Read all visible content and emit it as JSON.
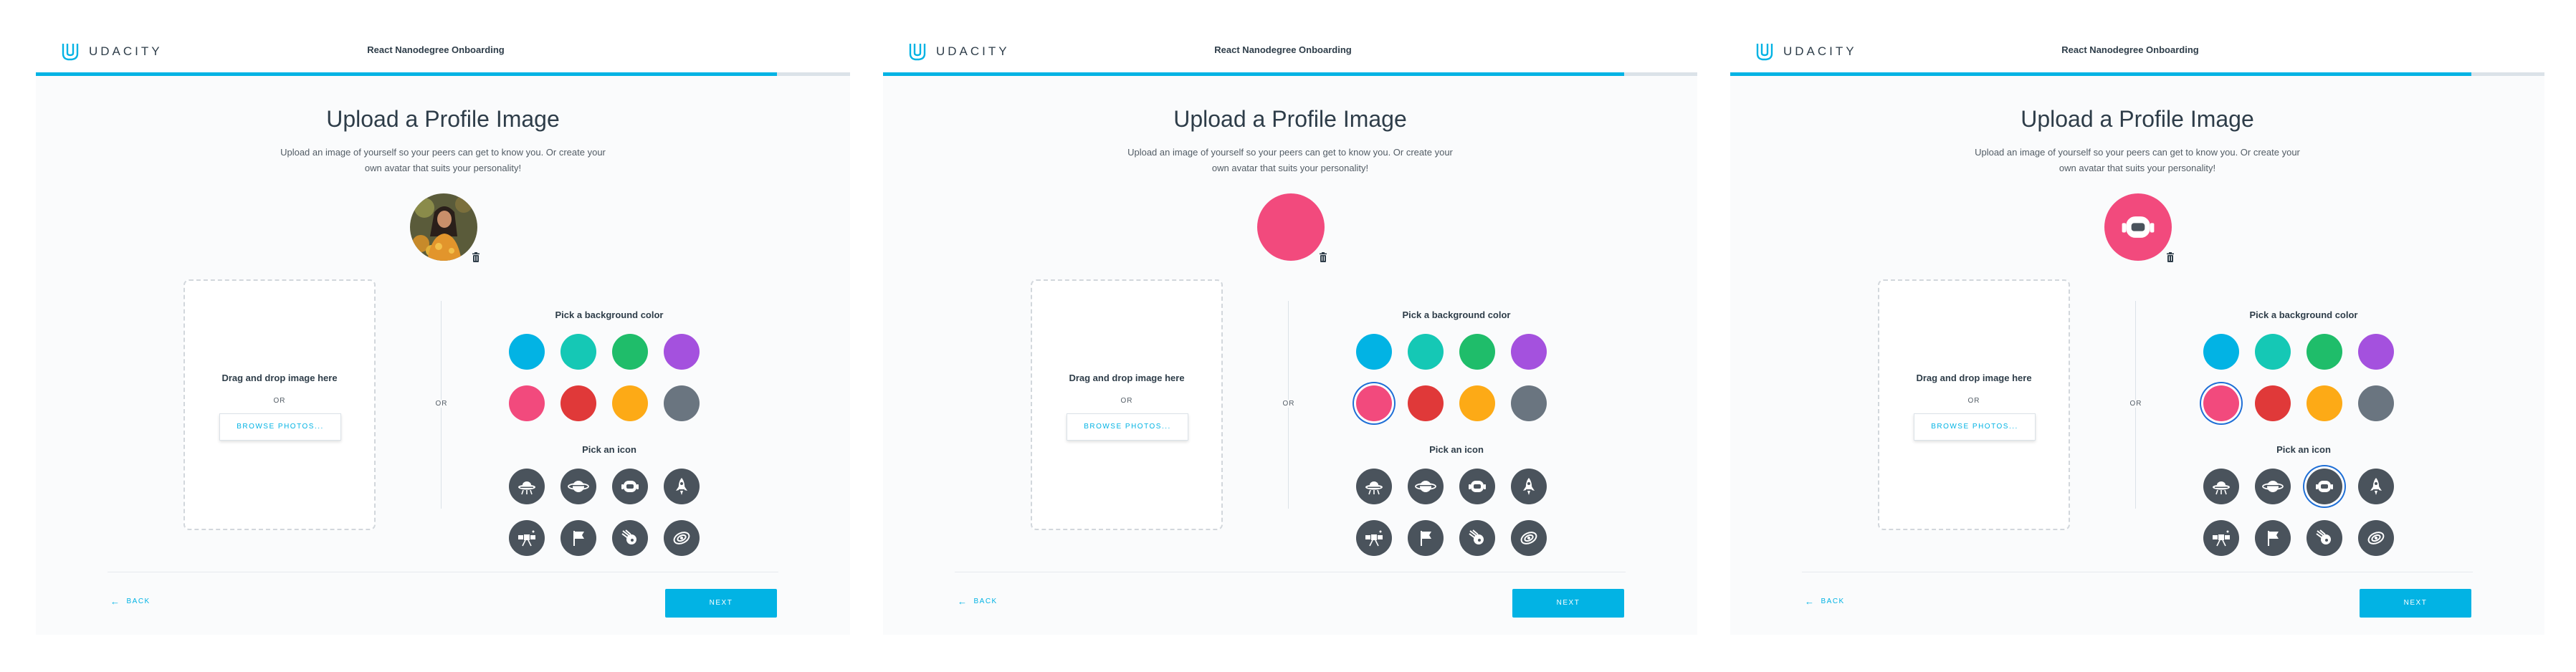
{
  "header": {
    "logo_text": "UDACITY",
    "course_title": "React Nanodegree Onboarding",
    "progress_percent": 91
  },
  "page": {
    "title": "Upload a Profile Image",
    "subtitle": "Upload an image of yourself so your peers can get to know you. Or create your own avatar that suits your personality!"
  },
  "dropzone": {
    "text": "Drag and drop image here",
    "or": "OR",
    "browse_label": "BROWSE PHOTOS..."
  },
  "or_divider": "OR",
  "colors": {
    "label": "Pick a background color",
    "swatches": [
      "#02b3e4",
      "#15c8b5",
      "#1fbd6a",
      "#a451de",
      "#f24a7d",
      "#e03939",
      "#fdaa16",
      "#6a7580"
    ]
  },
  "icons": {
    "label": "Pick an icon",
    "items": [
      "ufo-icon",
      "planet-icon",
      "astronaut-helmet-icon",
      "rocket-icon",
      "satellite-icon",
      "flag-icon",
      "comet-icon",
      "galaxy-icon"
    ]
  },
  "footer": {
    "back_label": "BACK",
    "next_label": "NEXT"
  },
  "states": [
    {
      "avatar": "photo",
      "selected_color": null,
      "selected_icon": null
    },
    {
      "avatar": "color",
      "avatar_color": "#f24a7d",
      "selected_color": 4,
      "selected_icon": null
    },
    {
      "avatar": "color-icon",
      "avatar_color": "#f24a7d",
      "avatar_icon": "astronaut-helmet-icon",
      "selected_color": 4,
      "selected_icon": 2
    }
  ]
}
